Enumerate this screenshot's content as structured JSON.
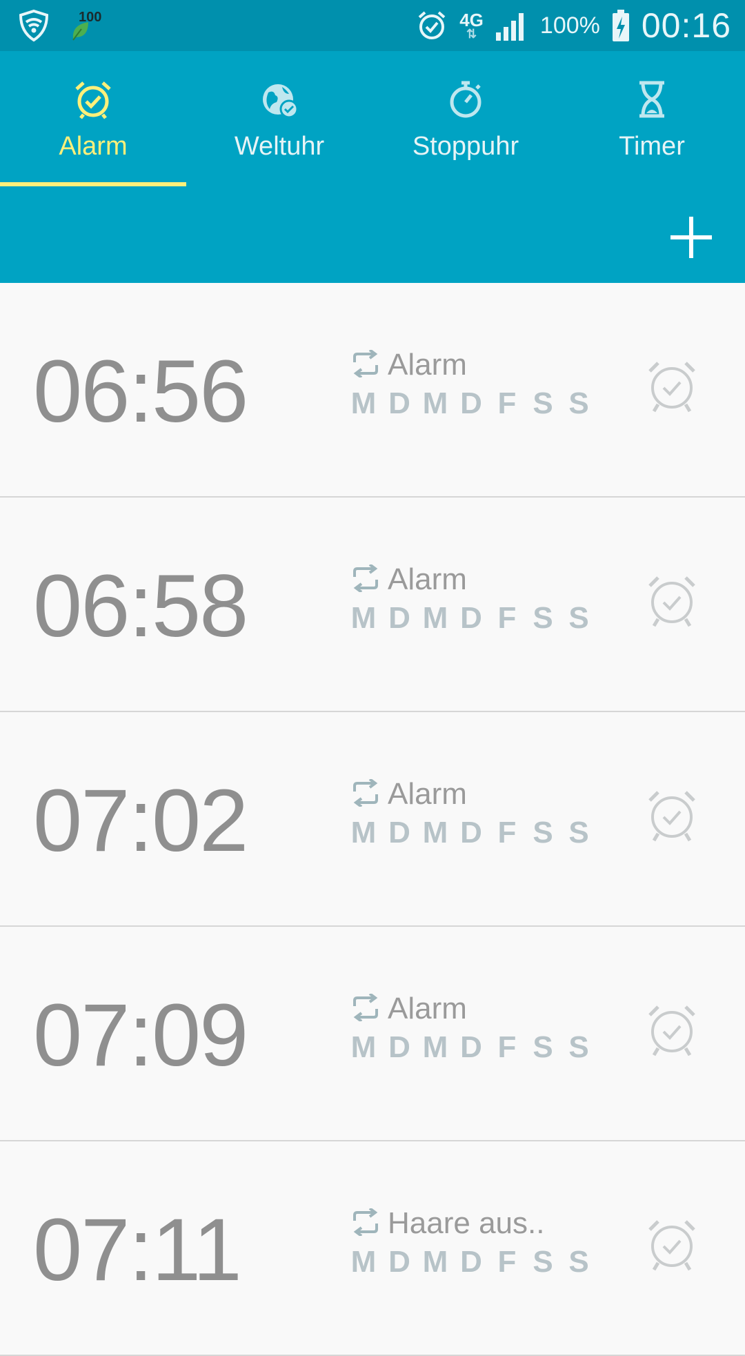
{
  "status_bar": {
    "badge_number": "100",
    "network": "4G",
    "battery": "100%",
    "time": "00:16",
    "icons": [
      "shield-wifi-icon",
      "leaf-icon",
      "alarm-icon",
      "signal-icon",
      "battery-charging-icon"
    ]
  },
  "tabs": [
    {
      "label": "Alarm",
      "icon": "alarm-clock-icon",
      "active": true
    },
    {
      "label": "Weltuhr",
      "icon": "globe-icon",
      "active": false
    },
    {
      "label": "Stoppuhr",
      "icon": "stopwatch-icon",
      "active": false
    },
    {
      "label": "Timer",
      "icon": "hourglass-icon",
      "active": false
    }
  ],
  "add_button": {
    "icon": "plus-icon"
  },
  "alarms": [
    {
      "time": "06:56",
      "name": "Alarm",
      "days": [
        "M",
        "D",
        "M",
        "D",
        "F",
        "S",
        "S"
      ]
    },
    {
      "time": "06:58",
      "name": "Alarm",
      "days": [
        "M",
        "D",
        "M",
        "D",
        "F",
        "S",
        "S"
      ]
    },
    {
      "time": "07:02",
      "name": "Alarm",
      "days": [
        "M",
        "D",
        "M",
        "D",
        "F",
        "S",
        "S"
      ]
    },
    {
      "time": "07:09",
      "name": "Alarm",
      "days": [
        "M",
        "D",
        "M",
        "D",
        "F",
        "S",
        "S"
      ]
    },
    {
      "time": "07:11",
      "name": "Haare aus..",
      "days": [
        "M",
        "D",
        "M",
        "D",
        "F",
        "S",
        "S"
      ]
    }
  ],
  "colors": {
    "header": "#00a3c3",
    "status_bar": "#0090ad",
    "active_tab": "#fff07a",
    "time_text": "#8f8f8f",
    "day_text": "#b7c3c8"
  }
}
